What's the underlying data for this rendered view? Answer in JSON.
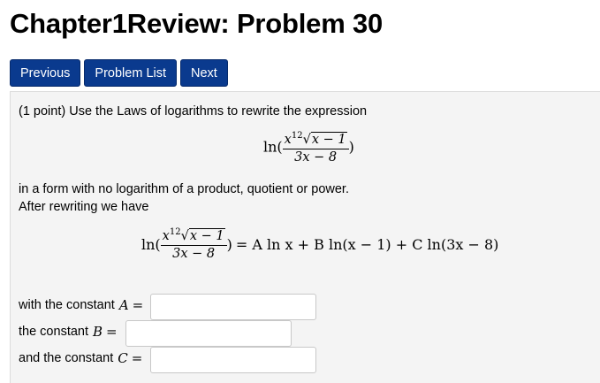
{
  "page_title": "Chapter1Review: Problem 30",
  "nav": {
    "previous": "Previous",
    "problem_list": "Problem List",
    "next": "Next"
  },
  "problem": {
    "intro": "(1 point) Use the Laws of logarithms to rewrite the expression",
    "expr": {
      "ln": "ln",
      "open": "(",
      "x": "x",
      "exp": "12",
      "radicand": "x − 1",
      "den": "3x − 8",
      "close": ")"
    },
    "line2": "in a form with no logarithm of a product, quotient or power.",
    "line3": "After rewriting we have",
    "equation_rhs": "= A ln x + B ln(x − 1) + C ln(3x − 8)",
    "constants": [
      {
        "label": "with the constant",
        "var": "A",
        "eq": "=",
        "value": ""
      },
      {
        "label": "the constant",
        "var": "B",
        "eq": "=",
        "value": ""
      },
      {
        "label": "and the constant",
        "var": "C",
        "eq": "=",
        "value": ""
      }
    ]
  }
}
